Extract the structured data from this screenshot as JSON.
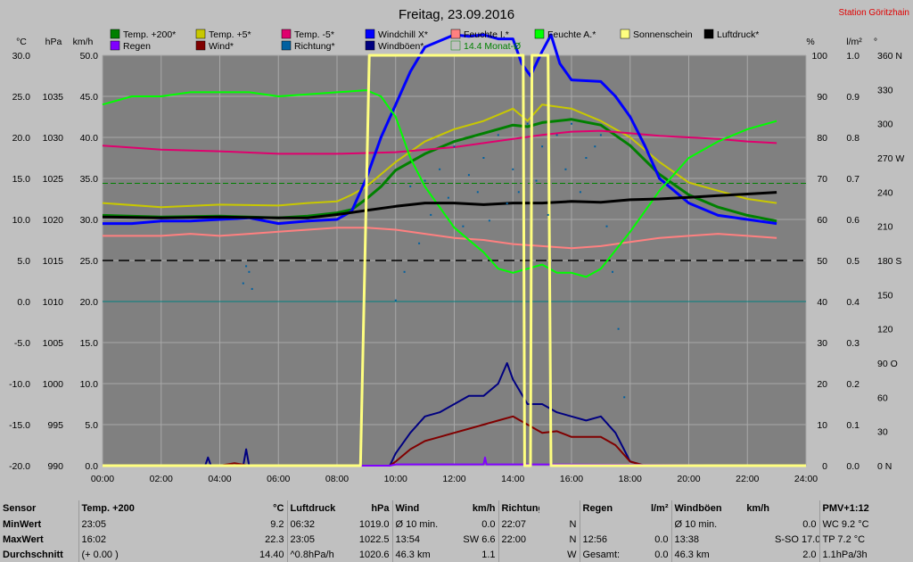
{
  "chart_data": {
    "type": "line",
    "title": "Freitag, 23.09.2016",
    "station": "Station Göritzhain",
    "axes": {
      "left_units": [
        "°C",
        "hPa",
        "km/h"
      ],
      "right_units": [
        "%",
        "l/m²",
        "°"
      ],
      "temp_ticks": [
        "30.0",
        "25.0",
        "20.0",
        "15.0",
        "10.0",
        "5.0",
        "0.0",
        "-5.0",
        "-10.0",
        "-15.0",
        "-20.0"
      ],
      "temp_range": [
        -20,
        30
      ],
      "pressure_ticks": [
        "1035",
        "1030",
        "1025",
        "1020",
        "1015",
        "1010",
        "1005",
        "1000",
        "995",
        "990"
      ],
      "pressure_range": [
        990,
        1040
      ],
      "wind_ticks": [
        "50.0",
        "45.0",
        "40.0",
        "35.0",
        "30.0",
        "25.0",
        "20.0",
        "15.0",
        "10.0",
        "5.0",
        "0.0"
      ],
      "wind_range": [
        0,
        50
      ],
      "percent_ticks": [
        "100",
        "90",
        "80",
        "70",
        "60",
        "50",
        "40",
        "30",
        "20",
        "10",
        "0"
      ],
      "percent_range": [
        0,
        100
      ],
      "rain_ticks": [
        "1.0",
        "0.9",
        "0.8",
        "0.7",
        "0.6",
        "0.5",
        "0.4",
        "0.3",
        "0.2",
        "0.1",
        "0.0"
      ],
      "rain_range": [
        0,
        1
      ],
      "dir_ticks": [
        "360 N",
        "330",
        "300",
        "270 W",
        "240",
        "210",
        "180 S",
        "150",
        "120",
        "90 O",
        "60",
        "30",
        "0 N"
      ],
      "dir_range": [
        0,
        360
      ],
      "x_ticks": [
        "00:00",
        "02:00",
        "04:00",
        "06:00",
        "08:00",
        "10:00",
        "12:00",
        "14:00",
        "16:00",
        "18:00",
        "20:00",
        "22:00",
        "24:00"
      ],
      "x_range": [
        0,
        24
      ],
      "grid": true
    },
    "legend": {
      "placement": "top",
      "entries": [
        {
          "name": "Temp. +200*",
          "color": "#008000"
        },
        {
          "name": "Temp. +5*",
          "color": "#c8c800"
        },
        {
          "name": "Temp. -5*",
          "color": "#e0006e"
        },
        {
          "name": "Windchill X*",
          "color": "#0000ff"
        },
        {
          "name": "Feuchte I.*",
          "color": "#ff8080"
        },
        {
          "name": "Feuchte A.*",
          "color": "#00ff00"
        },
        {
          "name": "Sonnenschein",
          "color": "#ffff80"
        },
        {
          "name": "Luftdruck*",
          "color": "#000000"
        },
        {
          "name": "Regen",
          "color": "#8000ff"
        },
        {
          "name": "Wind*",
          "color": "#800000"
        },
        {
          "name": "Richtung*",
          "color": "#0060a0"
        },
        {
          "name": "Windböen*",
          "color": "#000080"
        },
        {
          "name": "14.4 Monat-Ø",
          "color": "#008000"
        }
      ]
    },
    "series": [
      {
        "name": "Temp. +200*",
        "axis": "temp",
        "color": "#008000",
        "x": [
          0,
          2,
          4,
          6,
          7,
          8,
          8.5,
          9,
          9.5,
          10,
          11,
          12,
          13,
          14,
          14.5,
          15,
          16,
          17,
          18,
          19,
          20,
          21,
          22,
          23
        ],
        "y": [
          10.5,
          10.3,
          10.4,
          10.2,
          10.4,
          10.8,
          11.2,
          12.5,
          14,
          16,
          18,
          19.5,
          20.5,
          21.5,
          21.3,
          21.8,
          22.2,
          21.5,
          19,
          15.5,
          13,
          11.5,
          10.5,
          9.8
        ]
      },
      {
        "name": "Temp. +5*",
        "axis": "temp",
        "color": "#c8c800",
        "x": [
          0,
          2,
          4,
          6,
          7,
          8,
          8.5,
          9,
          9.5,
          10,
          11,
          12,
          13,
          14,
          14.5,
          15,
          16,
          17,
          18,
          19,
          20,
          21,
          22,
          23
        ],
        "y": [
          12,
          11.5,
          11.8,
          11.7,
          12,
          12.2,
          13,
          14,
          15.5,
          17,
          19.5,
          21,
          22,
          23.5,
          22,
          24,
          23.5,
          22,
          20,
          17,
          14.5,
          13.5,
          12.5,
          12
        ]
      },
      {
        "name": "Temp. -5*",
        "axis": "temp",
        "color": "#e0006e",
        "x": [
          0,
          2,
          4,
          6,
          8,
          10,
          12,
          13,
          14,
          15,
          16,
          17,
          18,
          19,
          20,
          21,
          22,
          23
        ],
        "y": [
          19,
          18.5,
          18.3,
          18,
          18,
          18.2,
          18.8,
          19.3,
          19.8,
          20.3,
          20.7,
          20.8,
          20.5,
          20.2,
          20,
          19.8,
          19.5,
          19.3
        ]
      },
      {
        "name": "Windchill X*",
        "axis": "temp",
        "color": "#0000ff",
        "x": [
          0,
          1,
          2,
          3,
          4,
          5,
          6,
          7,
          8,
          8.5,
          9,
          9.5,
          10,
          10.5,
          11,
          12,
          12.5,
          13,
          13.5,
          14,
          14.3,
          14.6,
          15,
          15.3,
          15.6,
          16,
          17,
          17.5,
          18,
          18.5,
          19,
          20,
          21,
          22,
          23
        ],
        "y": [
          9.5,
          9.5,
          9.8,
          9.8,
          10,
          10.2,
          9.5,
          9.8,
          10,
          11,
          15,
          20,
          24,
          28,
          31,
          32.5,
          32.3,
          32.5,
          32,
          32,
          29,
          27.5,
          30.5,
          32.5,
          29,
          27,
          26.8,
          25,
          22.5,
          19,
          15,
          12,
          10.5,
          10,
          9.5
        ]
      },
      {
        "name": "Feuchte I.*",
        "axis": "percent",
        "color": "#ff8080",
        "x": [
          0,
          2,
          3,
          4,
          5,
          6,
          7,
          8,
          9,
          10,
          11,
          12,
          13,
          14,
          15,
          16,
          17,
          18,
          19,
          20,
          21,
          22,
          23
        ],
        "y": [
          56,
          56,
          56.5,
          56,
          56.5,
          57,
          57.5,
          58,
          58,
          57.5,
          56.5,
          55.5,
          55,
          54,
          53.5,
          53,
          53.5,
          54.5,
          55.5,
          56,
          56.5,
          56,
          55.5
        ]
      },
      {
        "name": "Feuchte A.*",
        "axis": "percent",
        "color": "#00ff00",
        "x": [
          0,
          0.5,
          1,
          2,
          3,
          4,
          5,
          6,
          7,
          8,
          9,
          9.5,
          10,
          10.5,
          11,
          12,
          13,
          13.5,
          14,
          14.5,
          15,
          15.5,
          16,
          16.5,
          17,
          18,
          19,
          20,
          21,
          22,
          23
        ],
        "y": [
          88,
          89,
          90,
          90,
          91,
          91,
          91,
          90,
          90.5,
          91,
          91.5,
          90,
          85,
          75,
          68,
          58,
          52,
          48,
          47,
          48,
          49,
          47,
          47,
          46,
          48,
          57,
          67,
          75,
          79,
          82,
          84
        ]
      },
      {
        "name": "Luftdruck*",
        "axis": "pressure",
        "color": "#000000",
        "x": [
          0,
          2,
          4,
          6,
          7,
          8,
          9,
          10,
          11,
          12,
          13,
          14,
          15,
          16,
          17,
          18,
          19,
          20,
          21,
          22,
          23
        ],
        "y": [
          1020.3,
          1020.2,
          1020.3,
          1020.2,
          1020.2,
          1020.6,
          1021.1,
          1021.6,
          1022,
          1022,
          1021.8,
          1022,
          1022,
          1022.2,
          1022.1,
          1022.4,
          1022.5,
          1022.7,
          1022.9,
          1023.1,
          1023.3
        ]
      },
      {
        "name": "Windböen*",
        "axis": "wind",
        "color": "#000080",
        "x": [
          0,
          3.5,
          3.6,
          3.7,
          4.8,
          4.9,
          5,
          9.8,
          10,
          10.5,
          11,
          11.5,
          12,
          12.5,
          13,
          13.5,
          13.8,
          14,
          14.5,
          15,
          15.5,
          16,
          16.5,
          17,
          17.5,
          18,
          18.5
        ],
        "y": [
          0,
          0,
          1,
          0,
          0,
          2,
          0,
          0,
          1.5,
          4,
          6,
          6.5,
          7.5,
          8.5,
          8.5,
          10,
          12.5,
          10.5,
          7.5,
          7.5,
          6.5,
          6,
          5.5,
          6,
          4,
          0.5,
          0
        ]
      },
      {
        "name": "Wind*",
        "axis": "wind",
        "color": "#800000",
        "x": [
          0,
          4,
          4.5,
          5,
          9.8,
          10,
          10.5,
          11,
          11.5,
          12,
          12.5,
          13,
          13.5,
          14,
          14.5,
          15,
          15.5,
          16,
          16.5,
          17,
          17.5,
          18,
          18.5
        ],
        "y": [
          0,
          0,
          0.3,
          0,
          0,
          0.5,
          2,
          3,
          3.5,
          4,
          4.5,
          5,
          5.5,
          6,
          5,
          4,
          4.2,
          3.5,
          3.5,
          3.5,
          2.5,
          0.5,
          0
        ]
      },
      {
        "name": "Regen",
        "axis": "rain",
        "color": "#8000ff",
        "x": [
          0,
          9.8,
          10,
          13,
          13.05,
          13.1,
          14.5,
          24
        ],
        "y": [
          0,
          0,
          0.003,
          0.003,
          0.02,
          0.003,
          0.003,
          0
        ]
      },
      {
        "name": "Sonnenschein",
        "axis": "percent",
        "color": "#ffff80",
        "x": [
          0,
          8.8,
          9.1,
          14.35,
          14.4,
          14.6,
          14.65,
          14.75,
          14.8,
          15.2,
          15.3,
          24
        ],
        "y": [
          0,
          0,
          100,
          100,
          0,
          0,
          100,
          100,
          100,
          100,
          0,
          0
        ]
      }
    ],
    "direction_points": {
      "axis": "dir",
      "color": "#0060a0",
      "x": [
        4.8,
        4.9,
        5,
        5.1,
        10,
        10.3,
        10.5,
        10.8,
        11,
        11.2,
        11.5,
        11.8,
        12,
        12.3,
        12.5,
        12.8,
        13,
        13.2,
        13.5,
        13.8,
        14,
        14.2,
        14.5,
        14.8,
        15,
        15.2,
        15.5,
        15.8,
        16,
        16.3,
        16.5,
        16.8,
        17,
        17.2,
        17.4,
        17.6,
        17.8
      ],
      "y": [
        160,
        175,
        170,
        155,
        145,
        170,
        245,
        195,
        250,
        220,
        260,
        235,
        280,
        210,
        255,
        240,
        270,
        215,
        290,
        230,
        260,
        240,
        300,
        250,
        280,
        220,
        290,
        260,
        300,
        240,
        270,
        280,
        290,
        210,
        170,
        120,
        60
      ]
    },
    "reference_lines": [
      {
        "name": "14.4 Monat-Ø",
        "axis": "temp",
        "value": 14.4,
        "color": "#008000"
      },
      {
        "name": "Richtung 180 S",
        "axis": "dir",
        "value": 180,
        "color": "#000000"
      },
      {
        "name": "0 °C",
        "axis": "temp",
        "value": 0,
        "color": "#008080"
      }
    ]
  },
  "stats": {
    "header": [
      {
        "label": "Sensor"
      },
      {
        "label": "Temp. +200",
        "unit": "°C"
      },
      {
        "label": "Luftdruck",
        "unit": "hPa"
      },
      {
        "label": "Wind",
        "unit": "km/h"
      },
      {
        "label": "Richtung"
      },
      {
        "label": "Regen",
        "unit": "l/m²"
      },
      {
        "label": "Windböen",
        "unit": "km/h"
      },
      {
        "label": "PMV+1:12"
      }
    ],
    "rows": [
      {
        "label": "MinWert",
        "temp": [
          "23:05",
          "9.2"
        ],
        "press": [
          "06:32",
          "1019.0"
        ],
        "wind": [
          "Ø 10 min.",
          "0.0"
        ],
        "dir": [
          "22:07",
          "N"
        ],
        "rain": [
          "",
          ""
        ],
        "gust": [
          "Ø 10 min.",
          "0.0"
        ],
        "pmv": "WC 9.2 °C"
      },
      {
        "label": "MaxWert",
        "temp": [
          "16:02",
          "22.3"
        ],
        "press": [
          "23:05",
          "1022.5"
        ],
        "wind": [
          "13:54",
          "SW 6.6"
        ],
        "dir": [
          "22:00",
          "N"
        ],
        "rain": [
          "12:56",
          "0.0"
        ],
        "gust": [
          "13:38",
          "S-SO 17.0"
        ],
        "pmv": "TP 7.2 °C"
      },
      {
        "label": "Durchschnitt",
        "temp": [
          "(+ 0.00 )",
          "14.40"
        ],
        "press": [
          "^0.8hPa/h",
          "1020.6"
        ],
        "wind": [
          "46.3 km",
          "1.1"
        ],
        "dir": [
          "",
          "W"
        ],
        "rain": [
          "Gesamt:",
          "0.0"
        ],
        "gust": [
          "46.3 km",
          "2.0"
        ],
        "pmv": "1.1hPa/3h"
      }
    ]
  }
}
